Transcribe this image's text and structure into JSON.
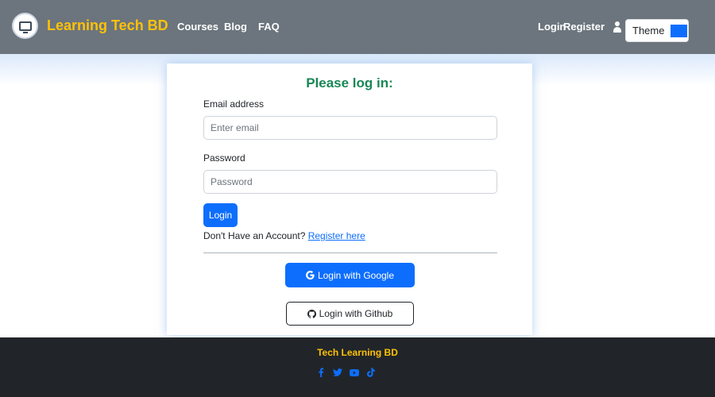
{
  "navbar": {
    "brand": "Learning Tech BD",
    "links": {
      "courses": "Courses",
      "blog": "Blog",
      "faq": "FAQ"
    },
    "auth": {
      "login": "Login",
      "register": "Register"
    },
    "theme": {
      "label": "Theme",
      "swatch_color": "#0d6efd"
    }
  },
  "login_form": {
    "title": "Please log in:",
    "email_label": "Email address",
    "email_placeholder": "Enter email",
    "email_value": "",
    "password_label": "Password",
    "password_placeholder": "Password",
    "password_value": "",
    "submit_label": "Login",
    "register_prompt": "Don't Have an Account?",
    "register_link": "Register here",
    "google_label": "Login with Google",
    "github_label": "Login with Github"
  },
  "footer": {
    "title": "Tech Learning BD",
    "social_icons": [
      "facebook-icon",
      "twitter-icon",
      "youtube-icon",
      "tiktok-icon"
    ]
  },
  "colors": {
    "navbar_bg": "#6c757d",
    "brand": "#ffc107",
    "primary": "#0d6efd",
    "title_green": "#198754",
    "footer_bg": "#212529"
  }
}
